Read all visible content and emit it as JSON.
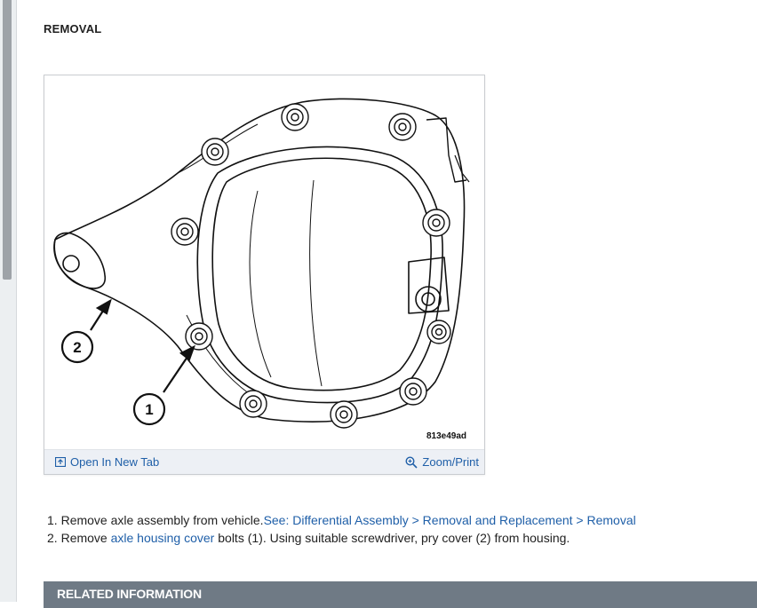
{
  "section": {
    "heading": "REMOVAL"
  },
  "figure": {
    "code": "813e49ad",
    "callouts": [
      "1",
      "2"
    ],
    "open_tab_label": "Open In New Tab",
    "zoom_label": "Zoom/Print",
    "open_tab_icon": "open-in-new-tab-icon",
    "zoom_icon": "magnifier-zoom-icon"
  },
  "steps": [
    {
      "number": "1.",
      "text": "Remove axle assembly from vehicle.",
      "link": "See: Differential Assembly > Removal and Replacement > Removal"
    },
    {
      "number": "2.",
      "text_before": "Remove ",
      "link": "axle housing cover",
      "text_after": " bolts (1). Using suitable screwdriver, pry cover (2) from housing."
    }
  ],
  "related": {
    "title": "RELATED INFORMATION"
  },
  "colors": {
    "link": "#1f5fa8",
    "related_bar": "#6f7a85",
    "figure_bar": "#edf0f5"
  }
}
